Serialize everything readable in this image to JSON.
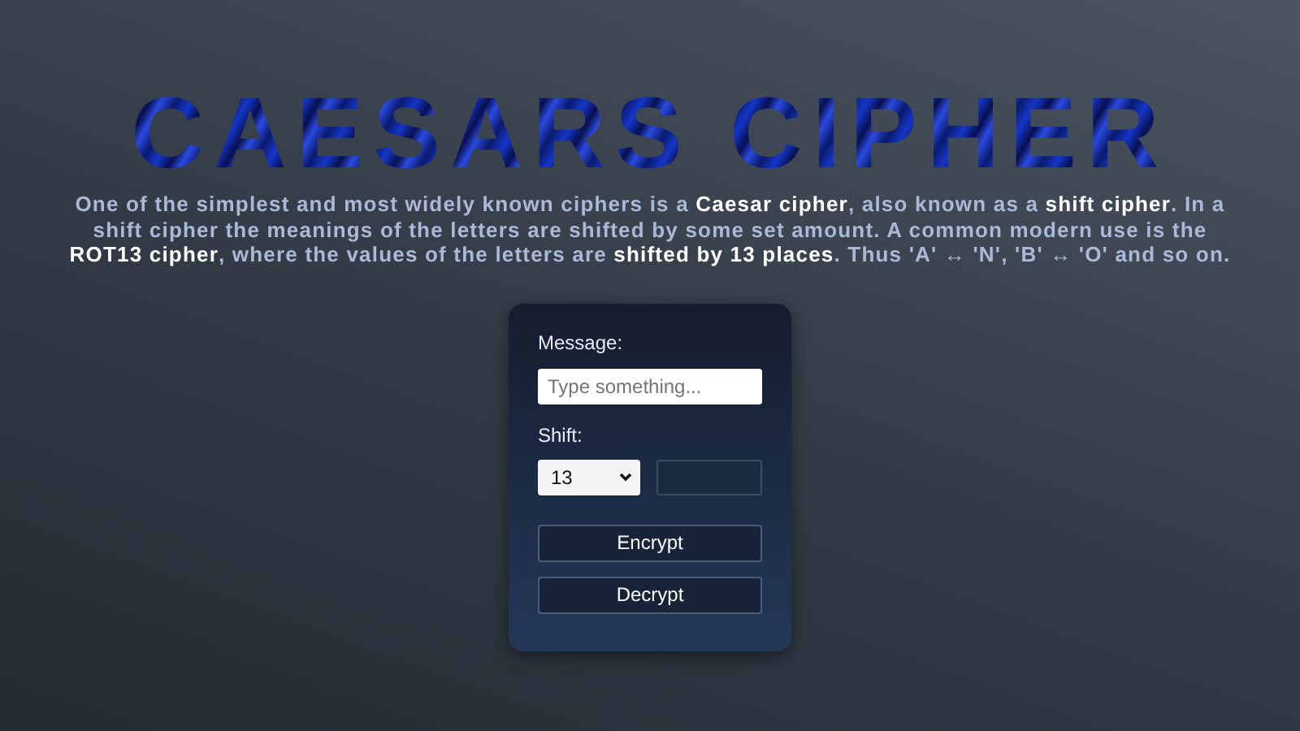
{
  "title": "CAESARS CIPHER",
  "description": "One of the simplest and most widely known ciphers is a **Caesar cipher**, also known as a **shift cipher**. In a shift cipher the meanings of the letters are shifted by some set amount. A common modern use is the **ROT13 cipher**, where the values of the letters are **shifted by 13 places**. Thus 'A' ↔ 'N', 'B' ↔ 'O' and so on.",
  "form": {
    "message_label": "Message:",
    "message_placeholder": "Type something...",
    "shift_label": "Shift:",
    "shift_value": "13",
    "buttons": [
      "Encrypt",
      "Decrypt"
    ]
  }
}
